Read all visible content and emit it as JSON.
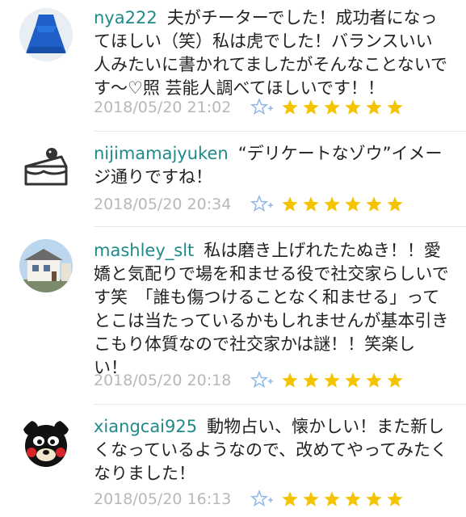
{
  "comments": [
    {
      "username": "nya222",
      "text": "夫がチーターでした！成功者になってほしい（笑）私は虎でした！バランスいい人みたいに書かれてましたがそんなことないです〜♡照 芸能人調べてほしいです！！",
      "timestamp": "2018/05/20 21:02",
      "rating": 6
    },
    {
      "username": "nijimamajyuken",
      "text": "“デリケートなゾウ”イメージ通りですね！",
      "timestamp": "2018/05/20 20:34",
      "rating": 6
    },
    {
      "username": "mashley_slt",
      "text": "私は磨き上げれたたぬき！！愛嬌と気配りで場を和ませる役で社交家らしいです笑　「誰も傷つけることなく和ませる」ってとこは当たっているかもしれませんが基本引きこもり体質なので社交家かは謎！！笑楽しい！",
      "timestamp": "2018/05/20 20:18",
      "rating": 6
    },
    {
      "username": "xiangcai925",
      "text": "動物占い、懐かしい！また新しくなっているようなので、改めてやってみたくなりました！",
      "timestamp": "2018/05/20 16:13",
      "rating": 6
    }
  ],
  "colors": {
    "username": "#1f8a8a",
    "timestamp": "#b8b8b8",
    "star": "#f5c400",
    "fav_icon": "#8fb8e8"
  },
  "icons": {
    "favorite": "star-plus-icon",
    "rating": "star-icon"
  }
}
